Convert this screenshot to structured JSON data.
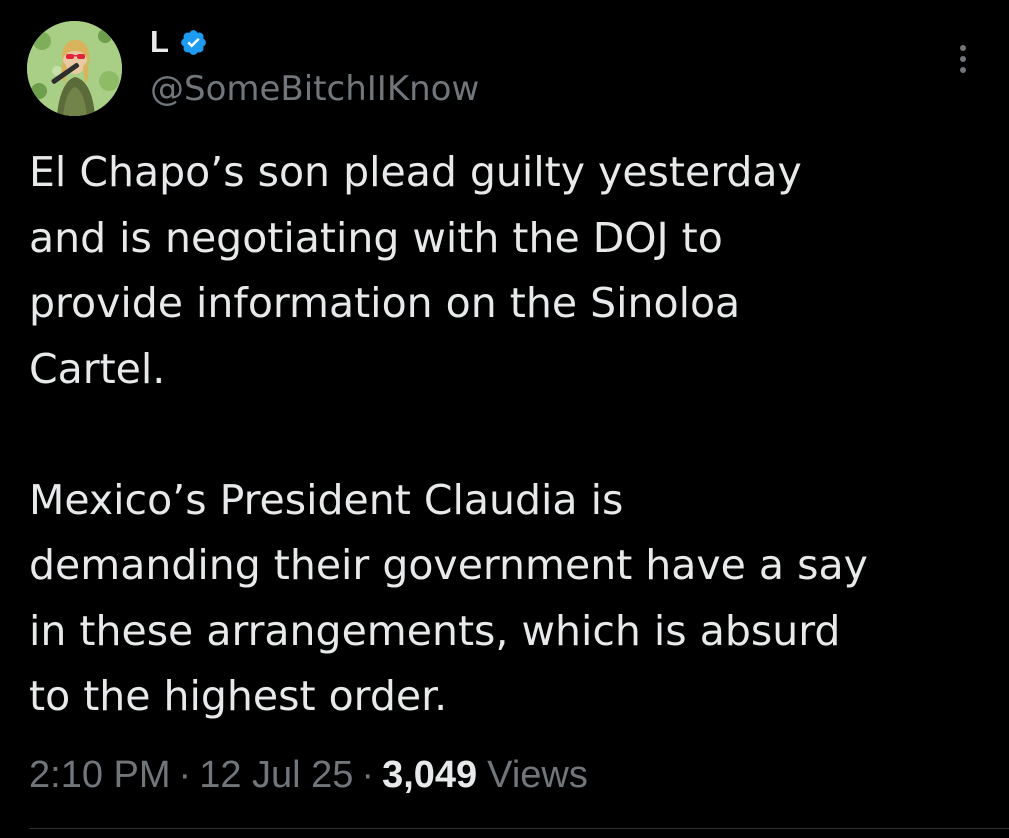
{
  "author": {
    "display_name": "L",
    "handle": "@SomeBitchIIKnow",
    "verified": true,
    "avatar_icon": "avatar-photo"
  },
  "tweet": {
    "paragraphs": [
      "El Chapo’s son plead guilty yesterday\nand is negotiating with the DOJ to\nprovide information on the Sinoloa\nCartel.",
      "Mexico’s President Claudia is\ndemanding their government have a say\nin these arrangements, which is absurd\nto the highest order."
    ]
  },
  "meta": {
    "time": "2:10 PM",
    "separator": "·",
    "date": "12 Jul 25",
    "views_count": "3,049",
    "views_label": "Views"
  },
  "colors": {
    "background": "#000000",
    "text_primary": "#e7e9ea",
    "text_secondary": "#71767b",
    "verified_blue": "#1d9bf0",
    "divider": "#2f3336"
  },
  "icons": {
    "verified": "verified-badge-icon",
    "more": "more-vertical-icon"
  }
}
